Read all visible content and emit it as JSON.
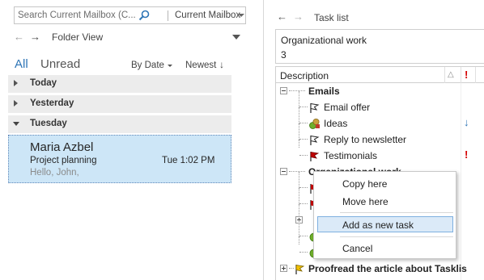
{
  "mail": {
    "search": {
      "placeholder": "Search Current Mailbox (C...",
      "scope": "Current Mailbox"
    },
    "nav": {
      "folder_view": "Folder View"
    },
    "filters": {
      "all": "All",
      "unread": "Unread",
      "sort_by": "By Date",
      "order": "Newest",
      "order_arrow": "↓"
    },
    "groups": [
      {
        "label": "Today",
        "expanded": false
      },
      {
        "label": "Yesterday",
        "expanded": false
      },
      {
        "label": "Tuesday",
        "expanded": true
      }
    ],
    "message": {
      "from": "Maria Azbel",
      "subject": "Project planning",
      "time": "Tue 1:02 PM",
      "preview": "Hello, John,"
    }
  },
  "tasks": {
    "header": {
      "title": "Task list"
    },
    "info": {
      "name": "Organizational work",
      "count": "3"
    },
    "columns": {
      "description": "Description",
      "flag_col": "△",
      "priority_col": "!"
    },
    "rows": {
      "emails": "Emails",
      "email_offer": "Email offer",
      "ideas": "Ideas",
      "reply_newsletter": "Reply to newsletter",
      "testimonials": "Testimonials",
      "organizational_work": "Organizational work",
      "proofread": "Proofread the article about Tasklis"
    },
    "markers": {
      "high_priority": "!",
      "low_priority": "↓"
    }
  },
  "context_menu": {
    "items": [
      "Copy here",
      "Move here",
      "Add as new task",
      "Cancel"
    ],
    "highlighted": "Add as new task"
  },
  "colors": {
    "accent": "#2e75b6",
    "selected_mail_bg": "#cde6f7",
    "menu_highlight": "#dbeaf8",
    "priority_red": "#d40000",
    "flag_red": "#c00000"
  },
  "icons": [
    "search-icon",
    "back-arrow-icon",
    "forward-arrow-icon",
    "dropdown-icon",
    "flag-outline-icon",
    "flag-red-icon",
    "task-group-icon",
    "flag-yellow-icon",
    "expand-collapse-icon"
  ]
}
